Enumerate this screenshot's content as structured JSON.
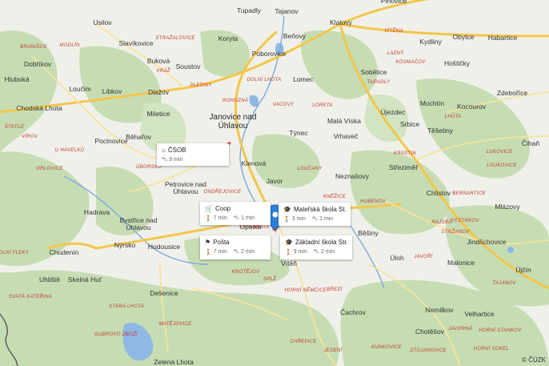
{
  "towns": [
    {
      "name": "Tupadly"
    },
    {
      "name": "Tajanov"
    },
    {
      "name": "Pinovice"
    },
    {
      "name": "Usilov"
    },
    {
      "name": "Koryta"
    },
    {
      "name": "Beňovy"
    },
    {
      "name": "Klatovy"
    },
    {
      "name": "Slavíkovice"
    },
    {
      "name": "Kydliny"
    },
    {
      "name": "Obytce"
    },
    {
      "name": "Habartice"
    },
    {
      "name": "Dobříkov"
    },
    {
      "name": "Buková"
    },
    {
      "name": "Soustov"
    },
    {
      "name": "Poborovice"
    },
    {
      "name": "Hoštičky"
    },
    {
      "name": "Hluboká"
    },
    {
      "name": "Sobětice"
    },
    {
      "name": "Lomec"
    },
    {
      "name": "Loučim"
    },
    {
      "name": "Libkov"
    },
    {
      "name": "Dlažov"
    },
    {
      "name": "Zdeboříce"
    },
    {
      "name": "Mochtín"
    },
    {
      "name": "Kocourov"
    },
    {
      "name": "Chodská Lhota"
    },
    {
      "name": "Miletice"
    },
    {
      "name": "Újezdec"
    },
    {
      "name": "Srbice"
    },
    {
      "name": "Malá Víska"
    },
    {
      "name": "Týnec"
    },
    {
      "name": "Těšetiny"
    },
    {
      "name": "Běhařov"
    },
    {
      "name": "Vrhaveč"
    },
    {
      "name": "Pocinovice"
    },
    {
      "name": "Čihaň"
    },
    {
      "name": "Klenová"
    },
    {
      "name": "Střeziměř"
    },
    {
      "name": "Javor"
    },
    {
      "name": "Neznašovy"
    },
    {
      "name": "Petrovice nad Úhlavou"
    },
    {
      "name": "Chlistov"
    },
    {
      "name": "Hadrava"
    },
    {
      "name": "Mlázovy"
    },
    {
      "name": "Bystřice nad Úhlavou"
    },
    {
      "name": "Opálka"
    },
    {
      "name": "Nýrsko"
    },
    {
      "name": "Hodousice"
    },
    {
      "name": "Běšiny"
    },
    {
      "name": "Jindřichovice"
    },
    {
      "name": "Chudenín"
    },
    {
      "name": "Vítěň"
    },
    {
      "name": "Úloh"
    },
    {
      "name": "Malonice"
    },
    {
      "name": "Újčín"
    },
    {
      "name": "Uhliště"
    },
    {
      "name": "Skelná Huť"
    },
    {
      "name": "Dešenice"
    },
    {
      "name": "Čachrov"
    },
    {
      "name": "Nemilkov"
    },
    {
      "name": "Velhartice"
    },
    {
      "name": "Chotěšov"
    },
    {
      "name": "Zelená Lhota"
    }
  ],
  "big_town": {
    "name": "Janovice nad Úhlavou"
  },
  "localities": [
    {
      "name": "BRANIŠOV"
    },
    {
      "name": "MODLÍN"
    },
    {
      "name": "STRAŽALOVICE"
    },
    {
      "name": "VÍTĚNA"
    },
    {
      "name": "VRÁŽ"
    },
    {
      "name": "LAZNÝ"
    },
    {
      "name": "KOSMAČOV"
    },
    {
      "name": "TUPADLY"
    },
    {
      "name": "DOLNÍ LHOTA"
    },
    {
      "name": "PLEŠINY"
    },
    {
      "name": "ROHOZNÁ"
    },
    {
      "name": "VACOVY"
    },
    {
      "name": "LORETA"
    },
    {
      "name": "LHŮTA"
    },
    {
      "name": "ŠTEFLE"
    },
    {
      "name": "VÍROV"
    },
    {
      "name": "U HAVELKŮ"
    },
    {
      "name": "ORLOVICE"
    },
    {
      "name": "ÚBORSKO"
    },
    {
      "name": "ONDŘEJOVICE"
    },
    {
      "name": "LOUČANY"
    },
    {
      "name": "KRÁSTIN"
    },
    {
      "name": "LUKOVICE"
    },
    {
      "name": "LOUKOVICE"
    },
    {
      "name": "BERNARTICE"
    },
    {
      "name": "HUBENOV"
    },
    {
      "name": "KNĚŽICE"
    },
    {
      "name": "RAJSKÁ"
    },
    {
      "name": "VÝSTRKOV"
    },
    {
      "name": "STRŽANOV"
    },
    {
      "name": "DOLNÍ FLEKY"
    },
    {
      "name": "BLATA"
    },
    {
      "name": "OPÁLKA"
    },
    {
      "name": "JAVOŘÍ"
    },
    {
      "name": "KROTĚJOV"
    },
    {
      "name": "SPLŽ"
    },
    {
      "name": "HORNÍ NĚMČICE"
    },
    {
      "name": "BŘEZÍ"
    },
    {
      "name": "TAJANOV"
    },
    {
      "name": "STARÁ LHOTA"
    },
    {
      "name": "MATĚJOVICE"
    },
    {
      "name": "SVATÁ KATEŘINA"
    },
    {
      "name": "GUBROVO ZBOŽÍ"
    },
    {
      "name": "HORNÍ STANKOV"
    },
    {
      "name": "JAVORNÁ"
    },
    {
      "name": "KUNKOVICE"
    },
    {
      "name": "STOJANOVICE"
    },
    {
      "name": "CHŘEPICE"
    },
    {
      "name": "HORNÍ SOKEL"
    },
    {
      "name": "JESENÍ"
    }
  ],
  "pois": [
    {
      "name": "ČSOB",
      "icon": "bank-icon",
      "walk": null,
      "drive": "9 min"
    },
    {
      "name": "Coop",
      "icon": "shopping-cart-icon",
      "walk": "7 min",
      "drive": "1 min"
    },
    {
      "name": "Mateřská škola St...",
      "icon": "school-icon",
      "walk": "3 min",
      "drive": "1 min"
    },
    {
      "name": "Pošta",
      "icon": "post-office-icon",
      "walk": "7 min",
      "drive": "2 min"
    },
    {
      "name": "Základní škola Str...",
      "icon": "school-icon",
      "walk": "9 min",
      "drive": "2 min"
    }
  ],
  "attribution": "© ČÚZK",
  "colors": {
    "forest": "#c4dcb2",
    "road": "#f6d25a",
    "river": "#6a9fd8",
    "pin": "#2a7fd6",
    "land": "#f0f0ea"
  }
}
